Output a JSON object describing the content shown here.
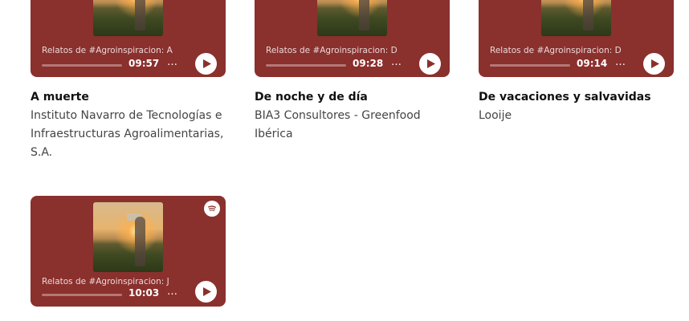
{
  "colors": {
    "accent": "#8a302d",
    "text_primary": "#111111",
    "text_secondary": "#444444"
  },
  "icons": {
    "play": "play-icon",
    "more": "more-icon",
    "spotify": "spotify-logo-icon"
  },
  "items": [
    {
      "player": {
        "episode": "Relatos de #Agroinspiracion: A",
        "duration": "09:57",
        "more": "…"
      },
      "title": "A muerte",
      "author": "Instituto Navarro de Tecnologías e Infraestructuras Agroalimentarias, S.A."
    },
    {
      "player": {
        "episode": "Relatos de #Agroinspiracion: D",
        "duration": "09:28",
        "more": "…"
      },
      "title": "De noche y de día",
      "author": "BIA3 Consultores - Greenfood Ibérica"
    },
    {
      "player": {
        "episode": "Relatos de #Agroinspiracion: D",
        "duration": "09:14",
        "more": "…"
      },
      "title": "De vacaciones y salvavidas",
      "author": "Looije"
    },
    {
      "player": {
        "episode": "Relatos de #Agroinspiracion: J",
        "duration": "10:03",
        "more": "…"
      },
      "title": "",
      "author": ""
    }
  ]
}
